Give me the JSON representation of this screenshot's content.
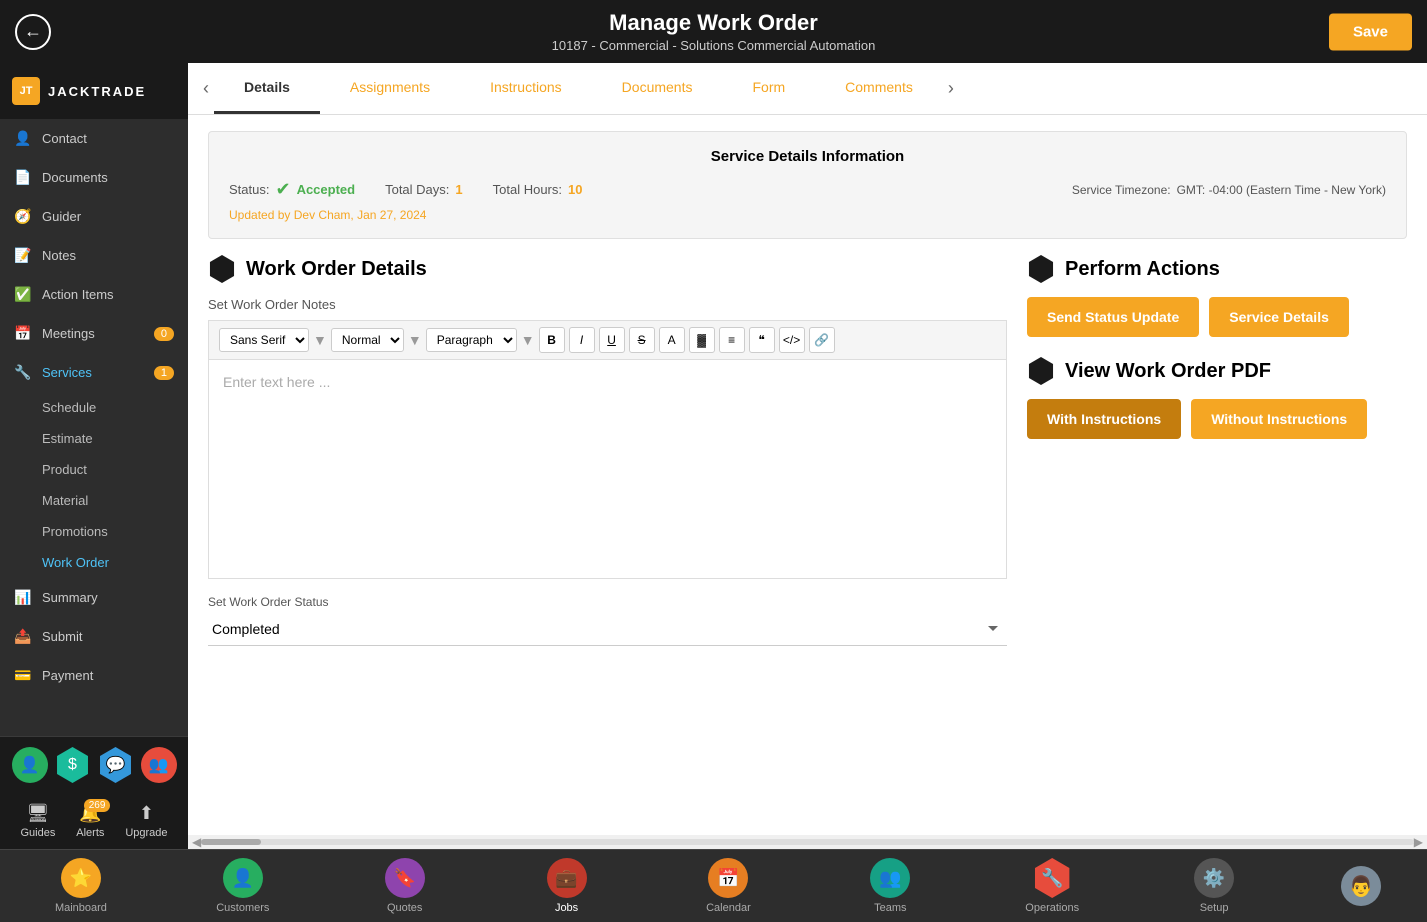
{
  "header": {
    "title": "Manage Work Order",
    "subtitle": "10187 - Commercial - Solutions Commercial Automation",
    "back_label": "←",
    "save_label": "Save"
  },
  "tabs": {
    "items": [
      {
        "label": "Details",
        "active": true
      },
      {
        "label": "Assignments",
        "active": false
      },
      {
        "label": "Instructions",
        "active": false
      },
      {
        "label": "Documents",
        "active": false
      },
      {
        "label": "Form",
        "active": false
      },
      {
        "label": "Comments",
        "active": false
      }
    ]
  },
  "service_info": {
    "title": "Service Details Information",
    "status_label": "Status:",
    "status_value": "Accepted",
    "total_days_label": "Total Days:",
    "total_days_value": "1",
    "total_hours_label": "Total Hours:",
    "total_hours_value": "10",
    "timezone_label": "Service Timezone:",
    "timezone_value": "GMT: -04:00 (Eastern Time - New York)",
    "updated_label": "Updated by",
    "updated_by": "Dev Cham",
    "updated_date": ", Jan 27, 2024"
  },
  "work_order": {
    "section_title": "Work Order Details",
    "notes_label": "Set Work Order Notes",
    "editor": {
      "font_family": "Sans Serif",
      "font_size": "Normal",
      "paragraph": "Paragraph",
      "placeholder": "Enter text here ..."
    },
    "status_section_label": "Set Work Order Status",
    "status_value": "Completed"
  },
  "perform_actions": {
    "section_title": "Perform Actions",
    "send_status_label": "Send Status Update",
    "service_details_label": "Service Details",
    "view_pdf_title": "View Work Order PDF",
    "with_instructions_label": "With Instructions",
    "without_instructions_label": "Without Instructions"
  },
  "sidebar": {
    "logo_text": "JACKTRADE",
    "items": [
      {
        "label": "Contact",
        "icon": "👤",
        "active": false
      },
      {
        "label": "Documents",
        "icon": "📄",
        "active": false
      },
      {
        "label": "Guider",
        "icon": "🧭",
        "active": false
      },
      {
        "label": "Notes",
        "icon": "📝",
        "active": false
      },
      {
        "label": "Action Items",
        "icon": "✅",
        "active": false
      },
      {
        "label": "Meetings",
        "icon": "📅",
        "active": false,
        "badge": "0"
      },
      {
        "label": "Services",
        "icon": "🔧",
        "active": true,
        "badge": "1"
      },
      {
        "label": "Summary",
        "icon": "📊",
        "active": false
      },
      {
        "label": "Submit",
        "icon": "📤",
        "active": false
      },
      {
        "label": "Payment",
        "icon": "💳",
        "active": false
      }
    ],
    "services_sub": [
      {
        "label": "Schedule"
      },
      {
        "label": "Estimate"
      },
      {
        "label": "Product"
      },
      {
        "label": "Material"
      },
      {
        "label": "Promotions"
      },
      {
        "label": "Work Order",
        "active": true
      }
    ]
  },
  "bottom_sidebar": {
    "guides_label": "Guides",
    "alerts_label": "Alerts",
    "alerts_badge": "269",
    "upgrade_label": "Upgrade"
  },
  "bottom_nav": {
    "items": [
      {
        "label": "Mainboard",
        "icon": "⭐",
        "color": "#f5a623",
        "active": false
      },
      {
        "label": "Customers",
        "icon": "👤",
        "color": "#27ae60",
        "active": false
      },
      {
        "label": "Quotes",
        "icon": "🔖",
        "color": "#8e44ad",
        "active": false
      },
      {
        "label": "Jobs",
        "icon": "💼",
        "color": "#c0392b",
        "active": true
      },
      {
        "label": "Calendar",
        "icon": "📅",
        "color": "#e67e22",
        "active": false
      },
      {
        "label": "Teams",
        "icon": "👥",
        "color": "#16a085",
        "active": false
      },
      {
        "label": "Operations",
        "icon": "🔧",
        "color": "#e74c3c",
        "active": false
      },
      {
        "label": "Setup",
        "icon": "⚙️",
        "color": "#666",
        "active": false
      }
    ]
  }
}
